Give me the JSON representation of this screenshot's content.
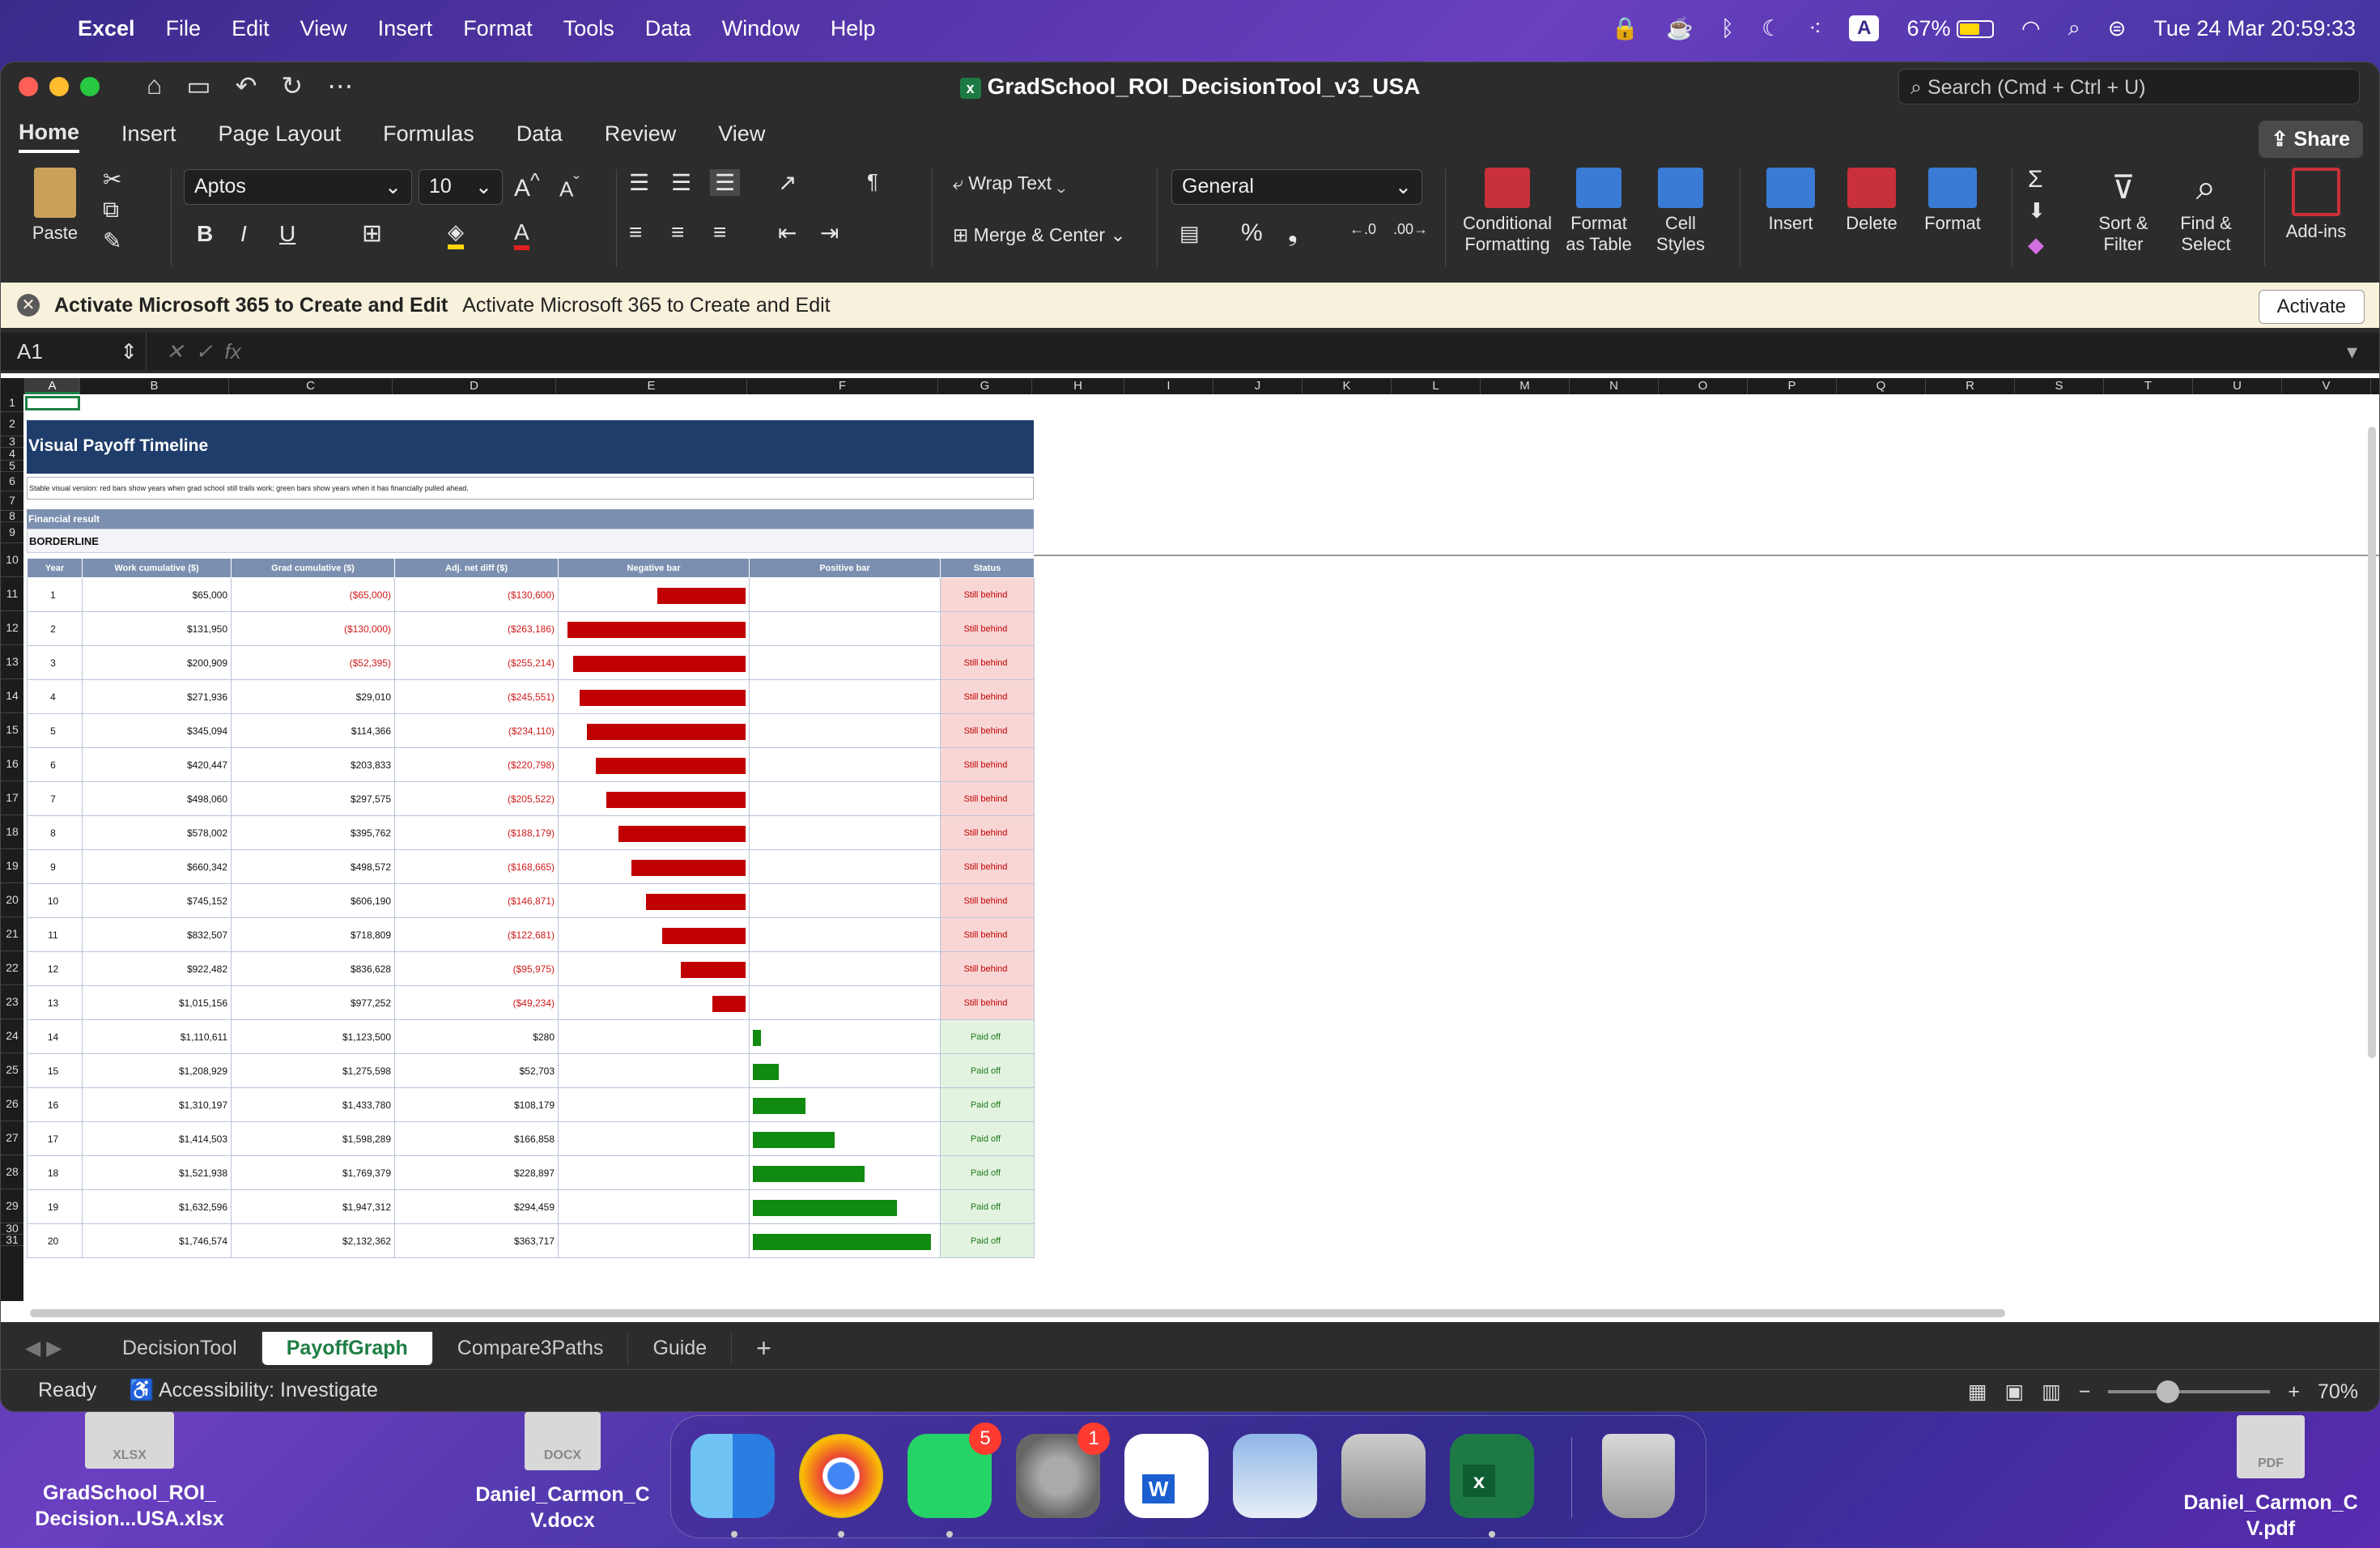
{
  "menubar": {
    "app": "Excel",
    "items": [
      "File",
      "Edit",
      "View",
      "Insert",
      "Format",
      "Tools",
      "Data",
      "Window",
      "Help"
    ],
    "battery": "67%",
    "input_source": "A",
    "clock": "Tue 24 Mar  20:59:33"
  },
  "window": {
    "title": "GradSchool_ROI_DecisionTool_v3_USA",
    "search_placeholder": "Search (Cmd + Ctrl + U)",
    "share_label": "Share"
  },
  "ribbon_tabs": [
    "Home",
    "Insert",
    "Page Layout",
    "Formulas",
    "Data",
    "Review",
    "View"
  ],
  "ribbon": {
    "paste": "Paste",
    "font": "Aptos",
    "font_size": "10",
    "wrap_text": "Wrap Text",
    "merge_center": "Merge & Center",
    "number_format": "General",
    "conditional_formatting": [
      "Conditional",
      "Formatting"
    ],
    "format_as_table": [
      "Format",
      "as Table"
    ],
    "cell_styles": [
      "Cell",
      "Styles"
    ],
    "insert": "Insert",
    "delete": "Delete",
    "format": "Format",
    "sort_filter": [
      "Sort &",
      "Filter"
    ],
    "find_select": [
      "Find &",
      "Select"
    ],
    "add_ins": "Add-ins"
  },
  "notice": {
    "bold": "Activate Microsoft 365 to Create and Edit",
    "text": "Activate Microsoft 365 to Create and Edit",
    "button": "Activate"
  },
  "formula_bar": {
    "name_box": "A1",
    "fx": "fx"
  },
  "columns": [
    "A",
    "B",
    "C",
    "D",
    "E",
    "F",
    "G",
    "H",
    "I",
    "J",
    "K",
    "L",
    "M",
    "N",
    "O",
    "P",
    "Q",
    "R",
    "S",
    "T",
    "U",
    "V"
  ],
  "rows": [
    "1",
    "2",
    "3",
    "4",
    "5",
    "6",
    "7",
    "8",
    "9",
    "10",
    "11",
    "12",
    "13",
    "14",
    "15",
    "16",
    "17",
    "18",
    "19",
    "20",
    "21",
    "22",
    "23",
    "24",
    "25",
    "26",
    "27",
    "28",
    "29",
    "30",
    "31"
  ],
  "sheet": {
    "title": "Visual Payoff Timeline",
    "subtitle": "Stable visual version: red bars show years when grad school still trails work; green bars show years when it has financially pulled ahead.",
    "financial_result_label": "Financial result",
    "financial_result_value": "BORDERLINE",
    "headers": [
      "Year",
      "Work cumulative ($)",
      "Grad cumulative ($)",
      "Adj. net diff ($)",
      "Negative bar",
      "Positive bar",
      "Status"
    ],
    "rows": [
      {
        "year": "1",
        "work": "$65,000",
        "grad": "($65,000)",
        "diff": "($130,600)",
        "v": -130600,
        "status": "Still behind"
      },
      {
        "year": "2",
        "work": "$131,950",
        "grad": "($130,000)",
        "diff": "($263,186)",
        "v": -263186,
        "status": "Still behind"
      },
      {
        "year": "3",
        "work": "$200,909",
        "grad": "($52,395)",
        "diff": "($255,214)",
        "v": -255214,
        "status": "Still behind"
      },
      {
        "year": "4",
        "work": "$271,936",
        "grad": "$29,010",
        "diff": "($245,551)",
        "v": -245551,
        "status": "Still behind"
      },
      {
        "year": "5",
        "work": "$345,094",
        "grad": "$114,366",
        "diff": "($234,110)",
        "v": -234110,
        "status": "Still behind"
      },
      {
        "year": "6",
        "work": "$420,447",
        "grad": "$203,833",
        "diff": "($220,798)",
        "v": -220798,
        "status": "Still behind"
      },
      {
        "year": "7",
        "work": "$498,060",
        "grad": "$297,575",
        "diff": "($205,522)",
        "v": -205522,
        "status": "Still behind"
      },
      {
        "year": "8",
        "work": "$578,002",
        "grad": "$395,762",
        "diff": "($188,179)",
        "v": -188179,
        "status": "Still behind"
      },
      {
        "year": "9",
        "work": "$660,342",
        "grad": "$498,572",
        "diff": "($168,665)",
        "v": -168665,
        "status": "Still behind"
      },
      {
        "year": "10",
        "work": "$745,152",
        "grad": "$606,190",
        "diff": "($146,871)",
        "v": -146871,
        "status": "Still behind"
      },
      {
        "year": "11",
        "work": "$832,507",
        "grad": "$718,809",
        "diff": "($122,681)",
        "v": -122681,
        "status": "Still behind"
      },
      {
        "year": "12",
        "work": "$922,482",
        "grad": "$836,628",
        "diff": "($95,975)",
        "v": -95975,
        "status": "Still behind"
      },
      {
        "year": "13",
        "work": "$1,015,156",
        "grad": "$977,252",
        "diff": "($49,234)",
        "v": -49234,
        "status": "Still behind"
      },
      {
        "year": "14",
        "work": "$1,110,611",
        "grad": "$1,123,500",
        "diff": "$280",
        "v": 280,
        "status": "Paid off"
      },
      {
        "year": "15",
        "work": "$1,208,929",
        "grad": "$1,275,598",
        "diff": "$52,703",
        "v": 52703,
        "status": "Paid off"
      },
      {
        "year": "16",
        "work": "$1,310,197",
        "grad": "$1,433,780",
        "diff": "$108,179",
        "v": 108179,
        "status": "Paid off"
      },
      {
        "year": "17",
        "work": "$1,414,503",
        "grad": "$1,598,289",
        "diff": "$166,858",
        "v": 166858,
        "status": "Paid off"
      },
      {
        "year": "18",
        "work": "$1,521,938",
        "grad": "$1,769,379",
        "diff": "$228,897",
        "v": 228897,
        "status": "Paid off"
      },
      {
        "year": "19",
        "work": "$1,632,596",
        "grad": "$1,947,312",
        "diff": "$294,459",
        "v": 294459,
        "status": "Paid off"
      },
      {
        "year": "20",
        "work": "$1,746,574",
        "grad": "$2,132,362",
        "diff": "$363,717",
        "v": 363717,
        "status": "Paid off"
      }
    ]
  },
  "sheet_tabs": [
    "DecisionTool",
    "PayoffGraph",
    "Compare3Paths",
    "Guide"
  ],
  "active_tab": "PayoffGraph",
  "status_bar": {
    "ready": "Ready",
    "accessibility": "Accessibility: Investigate",
    "zoom": "70%"
  },
  "desktop": {
    "file1": {
      "label1": "GradSchool_ROI_",
      "label2": "Decision...USA.xlsx",
      "type": "XLSX"
    },
    "file2": {
      "label1": "Daniel_Carmon_C",
      "label2": "V.docx",
      "type": "DOCX"
    },
    "file3": {
      "label1": "Daniel_Carmon_C",
      "label2": "V.pdf",
      "type": "PDF"
    }
  },
  "dock": {
    "whatsapp_badge": "5",
    "settings_badge": "1"
  },
  "colors": {
    "accent": "#1e7e45",
    "banner": "#1f3d6b",
    "neg": "#c00000",
    "pos": "#108a10"
  }
}
